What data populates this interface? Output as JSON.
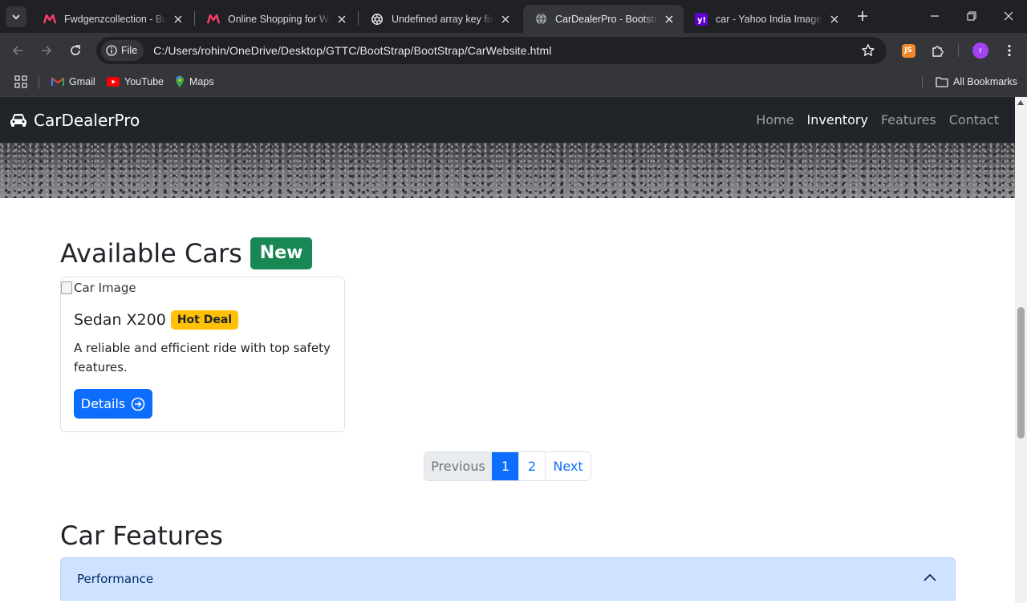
{
  "browser": {
    "tabs": [
      {
        "title": "Fwdgenzcollection - Buy",
        "favicon": "myntra-logo-icon",
        "active": false
      },
      {
        "title": "Online Shopping for Wor",
        "favicon": "myntra-logo-icon",
        "active": false
      },
      {
        "title": "Undefined array key fix",
        "favicon": "openai-logo-icon",
        "active": false
      },
      {
        "title": "CarDealerPro - Bootstrap",
        "favicon": "globe-icon",
        "active": true
      },
      {
        "title": "car - Yahoo India Image S",
        "favicon": "yahoo-logo-icon",
        "active": false
      }
    ],
    "site_chip": "File",
    "url": "C:/Users/rohin/OneDrive/Desktop/GTTC/BootStrap/BootStrap/CarWebsite.html",
    "profile_initial": "r",
    "extension_label": "JS",
    "bookmarks": [
      {
        "label": "Gmail",
        "icon": "gmail-icon"
      },
      {
        "label": "YouTube",
        "icon": "youtube-icon"
      },
      {
        "label": "Maps",
        "icon": "maps-pin-icon"
      }
    ],
    "all_bookmarks": "All Bookmarks"
  },
  "site": {
    "brand": "CarDealerPro",
    "nav": [
      {
        "label": "Home",
        "active": false
      },
      {
        "label": "Inventory",
        "active": true
      },
      {
        "label": "Features",
        "active": false
      },
      {
        "label": "Contact",
        "active": false
      }
    ]
  },
  "inventory": {
    "title": "Available Cars",
    "badge": "New",
    "card": {
      "image_alt": "Car Image",
      "title": "Sedan X200",
      "badge": "Hot Deal",
      "text": "A reliable and efficient ride with top safety features.",
      "button": "Details"
    },
    "pagination": {
      "previous": "Previous",
      "pages": [
        "1",
        "2"
      ],
      "current": "1",
      "next": "Next"
    }
  },
  "features": {
    "title": "Car Features",
    "accordion": [
      {
        "label": "Performance",
        "expanded": true
      }
    ]
  },
  "colors": {
    "primary": "#0d6efd",
    "success": "#198754",
    "warning": "#ffc107",
    "navbar": "#212529",
    "accordion_active": "#cfe2ff"
  }
}
